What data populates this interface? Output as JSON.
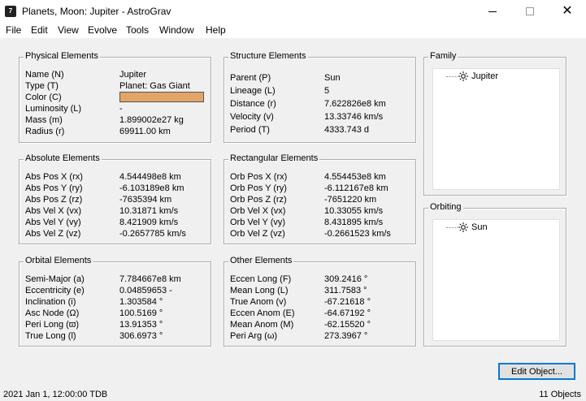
{
  "window": {
    "title": "Planets, Moon: Jupiter - AstroGrav",
    "app_icon": "7",
    "close_glyph": "✕"
  },
  "menu": [
    "File",
    "Edit",
    "View",
    "Evolve",
    "Tools",
    "Window",
    "Help"
  ],
  "physical": {
    "title": "Physical Elements",
    "color_swatch": "#e3a567",
    "rows": [
      {
        "label": "Name (N)",
        "value": "Jupiter"
      },
      {
        "label": "Type (T)",
        "value": "Planet: Gas Giant"
      },
      {
        "label": "Color (C)",
        "value": ""
      },
      {
        "label": "Luminosity (L)",
        "value": "-"
      },
      {
        "label": "Mass (m)",
        "value": "1.899002e27 kg"
      },
      {
        "label": "Radius (r)",
        "value": "69911.00 km"
      }
    ]
  },
  "structure": {
    "title": "Structure Elements",
    "rows": [
      {
        "label": "Parent (P)",
        "value": "Sun"
      },
      {
        "label": "Lineage (L)",
        "value": "5"
      },
      {
        "label": "Distance (r)",
        "value": "7.622826e8 km"
      },
      {
        "label": "Velocity (v)",
        "value": "13.33746 km/s"
      },
      {
        "label": "Period (T)",
        "value": "4333.743 d"
      }
    ]
  },
  "absolute": {
    "title": "Absolute Elements",
    "rows": [
      {
        "label": "Abs Pos X (rx)",
        "value": "4.544498e8 km"
      },
      {
        "label": "Abs Pos Y (ry)",
        "value": "-6.103189e8 km"
      },
      {
        "label": "Abs Pos Z (rz)",
        "value": "-7635394 km"
      },
      {
        "label": "Abs Vel X (vx)",
        "value": "10.31871 km/s"
      },
      {
        "label": "Abs Vel Y (vy)",
        "value": "8.421909 km/s"
      },
      {
        "label": "Abs Vel Z (vz)",
        "value": "-0.2657785 km/s"
      }
    ]
  },
  "rectangular": {
    "title": "Rectangular Elements",
    "rows": [
      {
        "label": "Orb Pos X (rx)",
        "value": "4.554453e8 km"
      },
      {
        "label": "Orb Pos Y (ry)",
        "value": "-6.112167e8 km"
      },
      {
        "label": "Orb Pos Z (rz)",
        "value": "-7651220 km"
      },
      {
        "label": "Orb Vel X (vx)",
        "value": "10.33055 km/s"
      },
      {
        "label": "Orb Vel Y (vy)",
        "value": "8.431895 km/s"
      },
      {
        "label": "Orb Vel Z (vz)",
        "value": "-0.2661523 km/s"
      }
    ]
  },
  "orbital": {
    "title": "Orbital Elements",
    "rows": [
      {
        "label": "Semi-Major (a)",
        "value": "7.784667e8 km"
      },
      {
        "label": "Eccentricity (e)",
        "value": "0.04859653 -"
      },
      {
        "label": "Inclination (i)",
        "value": "1.303584 °"
      },
      {
        "label": "Asc Node (Ω)",
        "value": "100.5169 °"
      },
      {
        "label": "Peri Long (ϖ)",
        "value": "13.91353 °"
      },
      {
        "label": "True Long (l)",
        "value": "306.6973 °"
      }
    ]
  },
  "other": {
    "title": "Other Elements",
    "rows": [
      {
        "label": "Eccen Long (F)",
        "value": "309.2416 °"
      },
      {
        "label": "Mean Long (L)",
        "value": "311.7583 °"
      },
      {
        "label": "True Anom (v)",
        "value": "-67.21618 °"
      },
      {
        "label": "Eccen Anom (E)",
        "value": "-64.67192 °"
      },
      {
        "label": "Mean Anom (M)",
        "value": "-62.15520 °"
      },
      {
        "label": "Peri Arg (ω)",
        "value": "273.3967 °"
      }
    ]
  },
  "family": {
    "title": "Family",
    "items": [
      "Jupiter"
    ]
  },
  "orbiting": {
    "title": "Orbiting",
    "items": [
      "Sun"
    ]
  },
  "edit_button": "Edit Object...",
  "status": {
    "left": "2021 Jan 1, 12:00:00 TDB",
    "right": "11 Objects"
  }
}
